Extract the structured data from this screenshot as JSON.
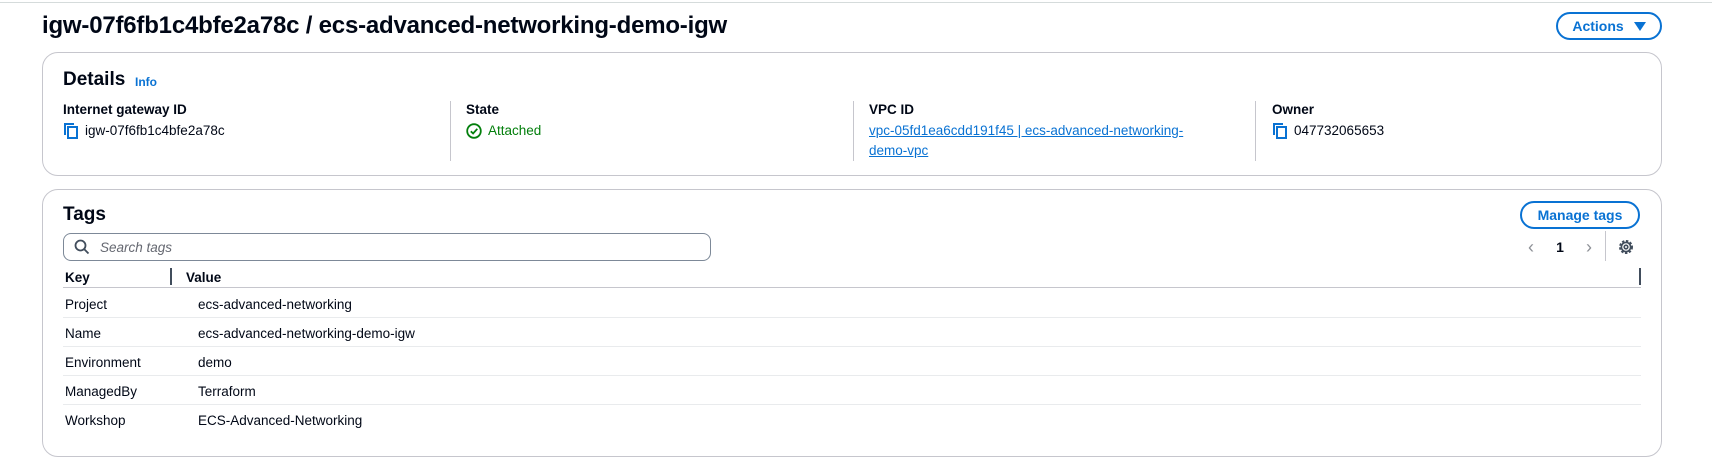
{
  "header": {
    "title": "igw-07f6fb1c4bfe2a78c / ecs-advanced-networking-demo-igw",
    "actions_label": "Actions"
  },
  "details": {
    "title": "Details",
    "info_label": "Info",
    "fields": {
      "gateway_id": {
        "label": "Internet gateway ID",
        "value": "igw-07f6fb1c4bfe2a78c"
      },
      "state": {
        "label": "State",
        "value": "Attached",
        "status_color": "#037f0c"
      },
      "vpc_id": {
        "label": "VPC ID",
        "value": "vpc-05fd1ea6cdd191f45 | ecs-advanced-networking-demo-vpc"
      },
      "owner": {
        "label": "Owner",
        "value": "047732065653"
      }
    }
  },
  "tags": {
    "title": "Tags",
    "manage_label": "Manage tags",
    "search_placeholder": "Search tags",
    "current_page": "1",
    "columns": {
      "key": "Key",
      "value": "Value"
    },
    "rows": [
      {
        "key": "Project",
        "value": "ecs-advanced-networking"
      },
      {
        "key": "Name",
        "value": "ecs-advanced-networking-demo-igw"
      },
      {
        "key": "Environment",
        "value": "demo"
      },
      {
        "key": "ManagedBy",
        "value": "Terraform"
      },
      {
        "key": "Workshop",
        "value": "ECS-Advanced-Networking"
      }
    ]
  },
  "theme": {
    "accent": "#0972d3",
    "success": "#037f0c",
    "border": "#c6c6cd"
  }
}
